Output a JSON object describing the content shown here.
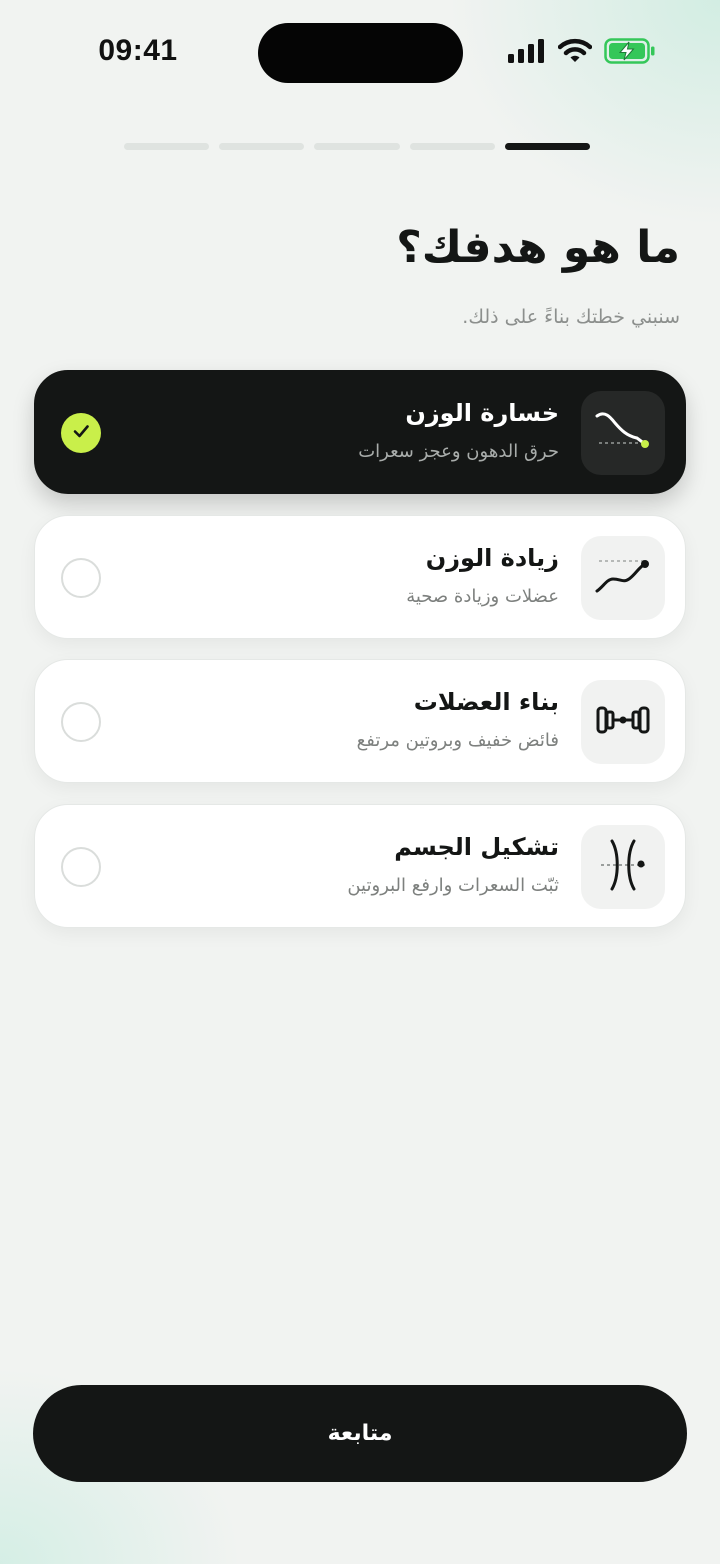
{
  "status_bar": {
    "time": "09:41",
    "icons": [
      "cellular-signal-icon",
      "wifi-icon",
      "battery-charging-icon"
    ],
    "battery_color": "#34c759"
  },
  "progress": {
    "total_steps": 5,
    "current_step": 5
  },
  "header": {
    "title": "ما هو هدفك؟",
    "subtitle": "سنبني خطتك بناءً على ذلك."
  },
  "goals": [
    {
      "label": "خسارة الوزن",
      "description": "حرق الدهون وعجز سعرات",
      "icon": "trend-down-icon",
      "selected": true
    },
    {
      "label": "زيادة الوزن",
      "description": "عضلات وزيادة صحية",
      "icon": "trend-up-icon",
      "selected": false
    },
    {
      "label": "بناء العضلات",
      "description": "فائض خفيف وبروتين مرتفع",
      "icon": "dumbbell-icon",
      "selected": false
    },
    {
      "label": "تشكيل الجسم",
      "description": "ثبّت السعرات وارفع البروتين",
      "icon": "body-shape-icon",
      "selected": false
    }
  ],
  "footer": {
    "continue_label": "متابعة"
  },
  "colors": {
    "accent": "#c9ef4a",
    "dark": "#141615",
    "background": "#f1f3f1"
  }
}
